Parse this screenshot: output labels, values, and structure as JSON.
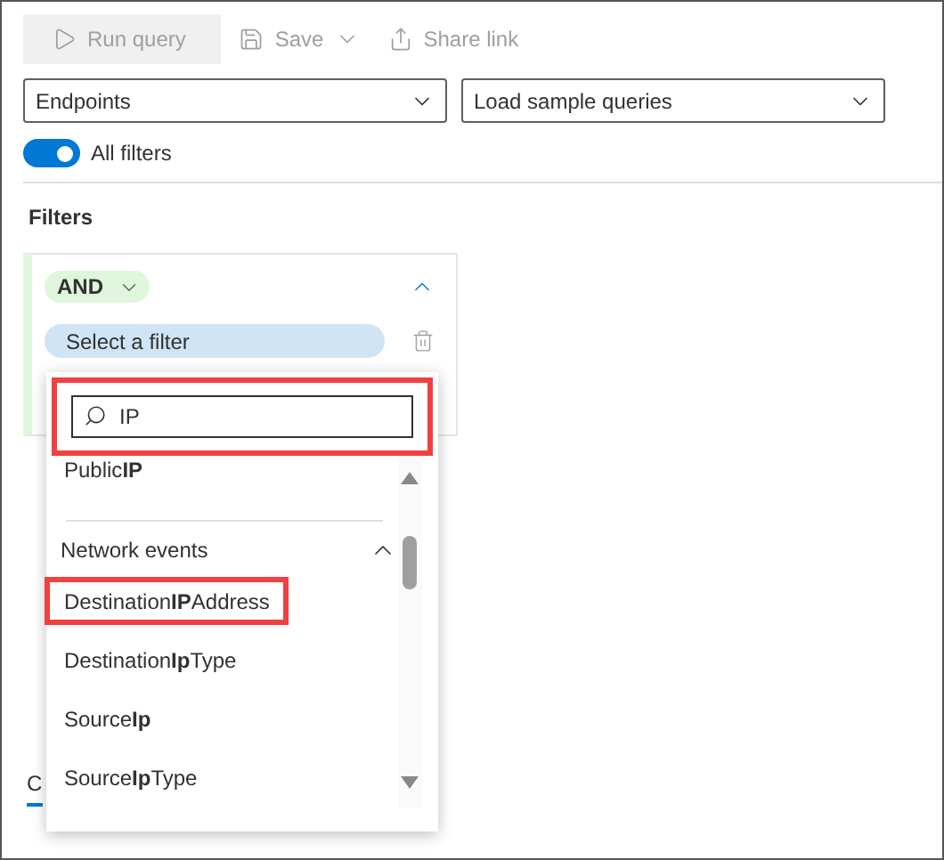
{
  "toolbar": [
    {
      "kind": "run",
      "label": "Run query",
      "disabled": true
    },
    {
      "kind": "save",
      "label": "Save",
      "disabled": true
    },
    {
      "kind": "share",
      "label": "Share link",
      "disabled": true
    }
  ],
  "selects": [
    {
      "value": "Endpoints"
    },
    {
      "value": "Load sample queries"
    }
  ],
  "all_filters": {
    "label": "All filters",
    "on": true
  },
  "filters_heading": "Filters",
  "filter_group": {
    "operator": "AND",
    "expanded": true,
    "filter_placeholder": "Select a filter"
  },
  "dropdown": {
    "search": {
      "value": "IP",
      "highlighted": true
    },
    "top_items": [
      {
        "label": "Public**IP**",
        "highlighted": false
      }
    ],
    "group": {
      "title": "Network events",
      "expanded": true,
      "items": [
        {
          "label": "Destination**IP**Address",
          "highlighted": true
        },
        {
          "label": "Destination**Ip**Type",
          "highlighted": false
        },
        {
          "label": "Source**Ip**",
          "highlighted": false
        },
        {
          "label": "Source**Ip**Type",
          "highlighted": false
        }
      ]
    }
  },
  "tab": {
    "label": "C",
    "selected": true
  }
}
